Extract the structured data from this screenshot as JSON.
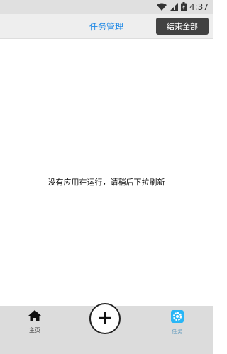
{
  "status_bar": {
    "time": "4:37",
    "icons": [
      "wifi-icon",
      "signal-icon",
      "battery-icon"
    ]
  },
  "header": {
    "title": "任务管理",
    "end_all_label": "结束全部"
  },
  "main": {
    "empty_message": "没有应用在运行，请稍后下拉刷新"
  },
  "bottom_nav": {
    "items": [
      {
        "label": "主页",
        "icon": "home-icon"
      },
      {
        "label": "任务",
        "icon": "gear-icon"
      }
    ],
    "center_action": "add-icon"
  },
  "colors": {
    "accent": "#1e88e5",
    "task_icon": "#29b6f6",
    "button_bg": "#424242",
    "nav_bg": "#dcdcdc",
    "header_bg": "#eeeeee"
  }
}
